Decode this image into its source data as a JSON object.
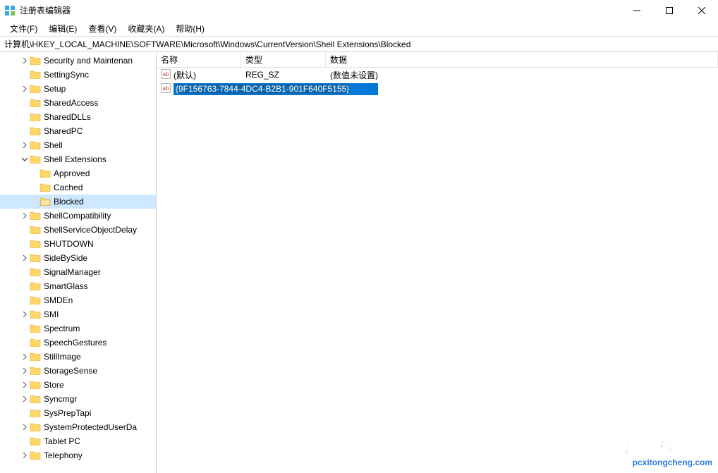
{
  "window": {
    "title": "注册表编辑器"
  },
  "menu": {
    "file": "文件(F)",
    "edit": "编辑(E)",
    "view": "查看(V)",
    "favorites": "收藏夹(A)",
    "help": "帮助(H)"
  },
  "address": "计算机\\HKEY_LOCAL_MACHINE\\SOFTWARE\\Microsoft\\Windows\\CurrentVersion\\Shell Extensions\\Blocked",
  "tree": [
    {
      "indent": 2,
      "exp": ">",
      "label": "Security and Maintenan"
    },
    {
      "indent": 2,
      "exp": "",
      "label": "SettingSync"
    },
    {
      "indent": 2,
      "exp": ">",
      "label": "Setup"
    },
    {
      "indent": 2,
      "exp": "",
      "label": "SharedAccess"
    },
    {
      "indent": 2,
      "exp": "",
      "label": "SharedDLLs"
    },
    {
      "indent": 2,
      "exp": "",
      "label": "SharedPC"
    },
    {
      "indent": 2,
      "exp": ">",
      "label": "Shell"
    },
    {
      "indent": 2,
      "exp": "v",
      "label": "Shell Extensions"
    },
    {
      "indent": 3,
      "exp": "",
      "label": "Approved"
    },
    {
      "indent": 3,
      "exp": "",
      "label": "Cached"
    },
    {
      "indent": 3,
      "exp": "",
      "label": "Blocked",
      "selected": true
    },
    {
      "indent": 2,
      "exp": ">",
      "label": "ShellCompatibility"
    },
    {
      "indent": 2,
      "exp": "",
      "label": "ShellServiceObjectDelay"
    },
    {
      "indent": 2,
      "exp": "",
      "label": "SHUTDOWN"
    },
    {
      "indent": 2,
      "exp": ">",
      "label": "SideBySide"
    },
    {
      "indent": 2,
      "exp": "",
      "label": "SignalManager"
    },
    {
      "indent": 2,
      "exp": "",
      "label": "SmartGlass"
    },
    {
      "indent": 2,
      "exp": "",
      "label": "SMDEn"
    },
    {
      "indent": 2,
      "exp": ">",
      "label": "SMI"
    },
    {
      "indent": 2,
      "exp": "",
      "label": "Spectrum"
    },
    {
      "indent": 2,
      "exp": "",
      "label": "SpeechGestures"
    },
    {
      "indent": 2,
      "exp": ">",
      "label": "StillImage"
    },
    {
      "indent": 2,
      "exp": ">",
      "label": "StorageSense"
    },
    {
      "indent": 2,
      "exp": ">",
      "label": "Store"
    },
    {
      "indent": 2,
      "exp": ">",
      "label": "Syncmgr"
    },
    {
      "indent": 2,
      "exp": "",
      "label": "SysPrepTapi"
    },
    {
      "indent": 2,
      "exp": ">",
      "label": "SystemProtectedUserDa"
    },
    {
      "indent": 2,
      "exp": "",
      "label": "Tablet PC"
    },
    {
      "indent": 2,
      "exp": ">",
      "label": "Telephony"
    }
  ],
  "list": {
    "headers": {
      "name": "名称",
      "type": "类型",
      "data": "数据"
    },
    "rows": [
      {
        "name": "(默认)",
        "type": "REG_SZ",
        "data": "(数值未设置)",
        "editing": false
      },
      {
        "name": "{9F156763-7844-4DC4-B2B1-901F640F5155}",
        "type": "",
        "data": "",
        "editing": true
      }
    ]
  },
  "watermark": {
    "line1": "电脑系统城",
    "line2": "pcxitongcheng.com"
  }
}
